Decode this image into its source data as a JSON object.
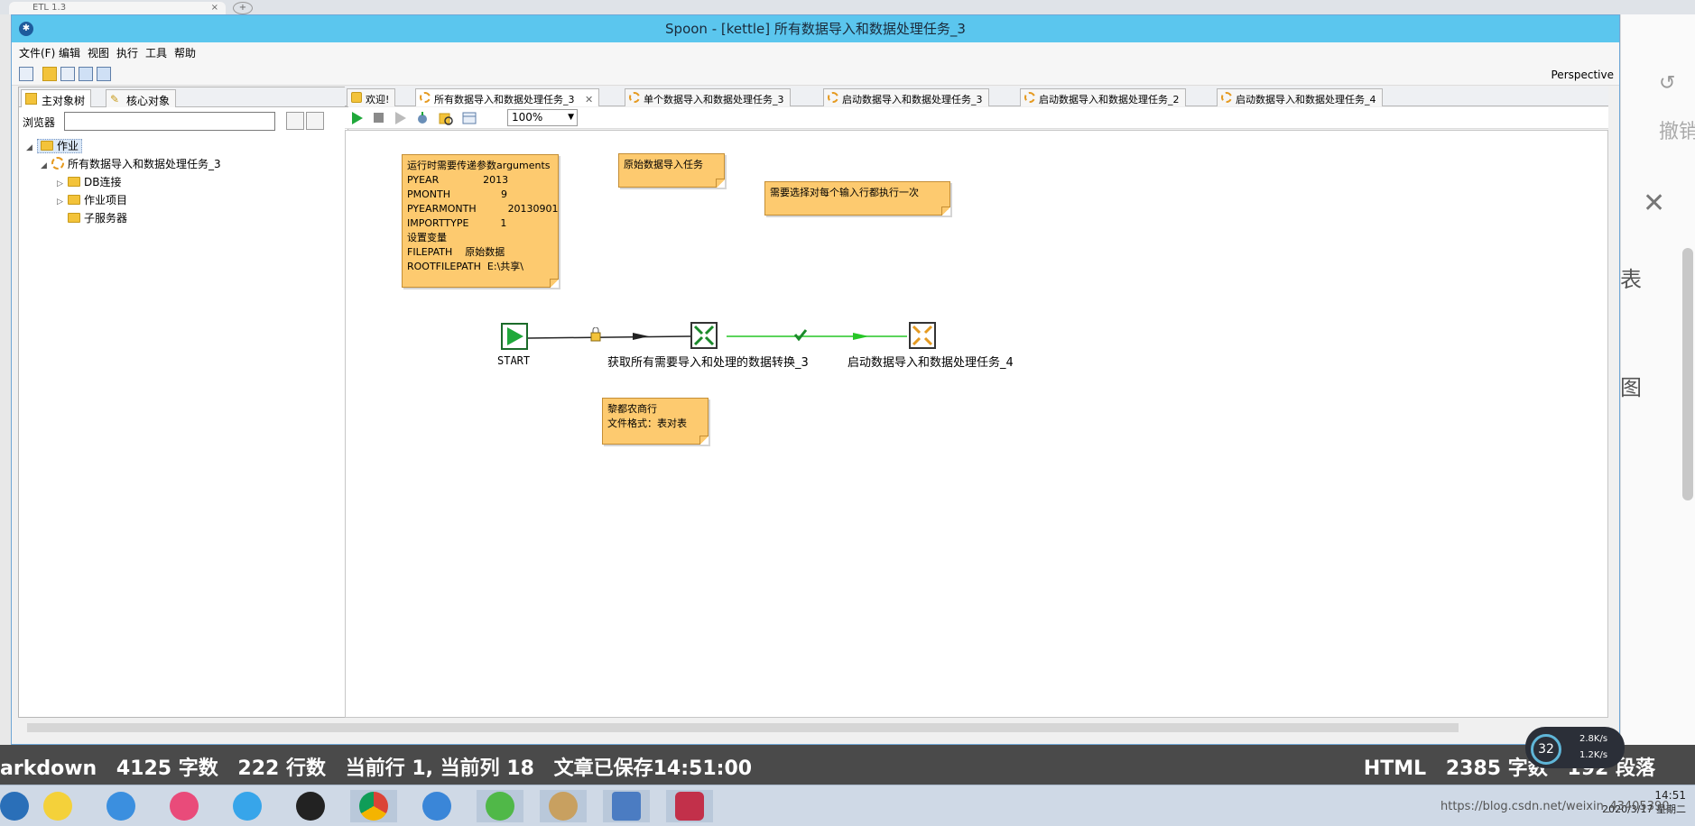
{
  "window": {
    "title": "Spoon - [kettle] 所有数据导入和数据处理任务_3"
  },
  "menu": [
    "文件(F)",
    "编辑",
    "视图",
    "执行",
    "工具",
    "帮助"
  ],
  "toolbar": {
    "perspective": "Perspective"
  },
  "left_panel": {
    "tabs": [
      "主对象树",
      "核心对象"
    ],
    "browser_label": "浏览器",
    "browser_value": "",
    "tree": {
      "root": "作业",
      "job": "所有数据导入和数据处理任务_3",
      "children": [
        "DB连接",
        "作业项目",
        "子服务器"
      ]
    }
  },
  "main_tabs": [
    "欢迎!",
    "所有数据导入和数据处理任务_3",
    "单个数据导入和数据处理任务_3",
    "启动数据导入和数据处理任务_3",
    "启动数据导入和数据处理任务_2",
    "启动数据导入和数据处理任务_4"
  ],
  "canvas_toolbar": {
    "zoom": "100%"
  },
  "notes": {
    "params": "运行时需要传递参数arguments\nPYEAR              2013\nPMONTH                9\nPYEARMONTH          20130901\nIMPORTTYPE          1\n设置变量\nFILEPATH    原始数据\nROOTFILEPATH  E:\\共享\\",
    "original_import": "原始数据导入任务",
    "each_row": "需要选择对每个输入行都执行一次",
    "bank": "黎都农商行\n文件格式：表对表"
  },
  "nodes": {
    "start": "START",
    "transform": "获取所有需要导入和处理的数据转换_3",
    "job": "启动数据导入和数据处理任务_4"
  },
  "statusbar": {
    "mode": "arkdown",
    "words": "4125 字数",
    "lines": "222 行数",
    "cursor": "当前行 1, 当前列 18",
    "saved": "文章已保存14:51:00",
    "format": "HTML",
    "chars": "2385 字数",
    "paragraphs": "192 段落"
  },
  "speed": {
    "percent": "32",
    "up": "2.8K/s",
    "down": "1.2K/s"
  },
  "taskbar": {
    "time": "14:51",
    "date": "2020/3/17 星期二",
    "watermark": "https://blog.csdn.net/weixin_43405390"
  },
  "background": {
    "browser_tab": "ETL 1.3",
    "undo": "撤销",
    "biao": "表",
    "tu": "图"
  },
  "colors": {
    "note_bg": "#fdca6f",
    "titlebar": "#5bc6ee",
    "start_green": "#1fa83a",
    "hop_green": "#27c627"
  }
}
